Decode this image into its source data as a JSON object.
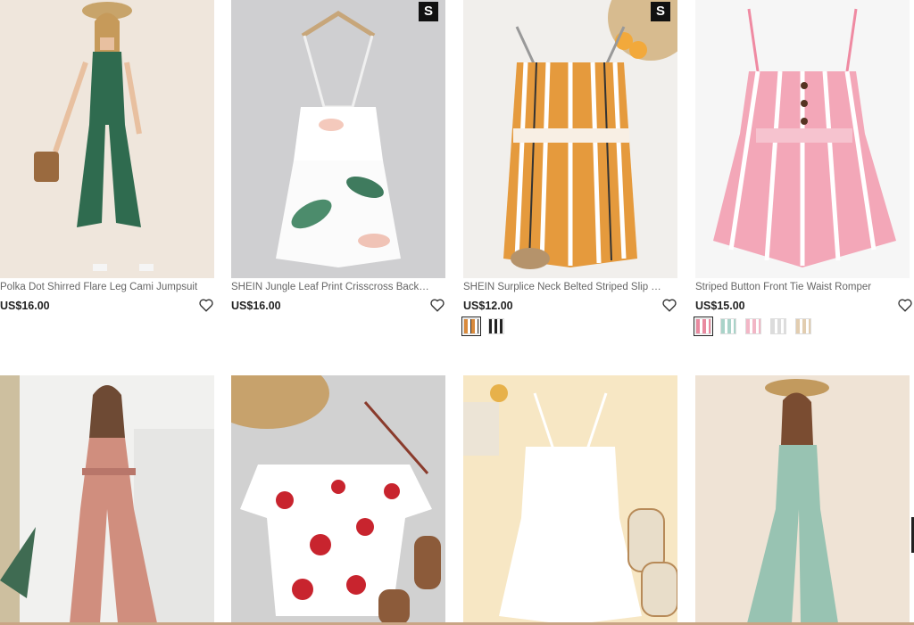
{
  "products": [
    {
      "title": "Polka Dot Shirred Flare Leg Cami Jumpsuit",
      "price": "US$16.00",
      "badge": "",
      "swatches": []
    },
    {
      "title": "SHEIN Jungle Leaf Print Crisscross Back Pr...",
      "price": "US$16.00",
      "badge": "S",
      "swatches": []
    },
    {
      "title": "SHEIN Surplice Neck Belted Striped Slip Ro...",
      "price": "US$12.00",
      "badge": "S",
      "swatches": [
        "#d98a3c",
        "#222222"
      ]
    },
    {
      "title": "Striped Button Front Tie Waist Romper",
      "price": "US$15.00",
      "badge": "",
      "swatches": [
        "#e98aa0",
        "#a9d3c9",
        "#f2b6c6",
        "#dcdcdc",
        "#e2cdb0"
      ]
    },
    {
      "title": "",
      "price": "",
      "badge": "",
      "swatches": []
    },
    {
      "title": "",
      "price": "",
      "badge": "",
      "swatches": []
    },
    {
      "title": "",
      "price": "",
      "badge": "",
      "swatches": []
    },
    {
      "title": "",
      "price": "",
      "badge": "",
      "swatches": []
    }
  ],
  "icons": {
    "favorite": "heart-outline-icon"
  },
  "colors": {
    "accent": "#222222",
    "bottom_bar": "#c9a585"
  }
}
